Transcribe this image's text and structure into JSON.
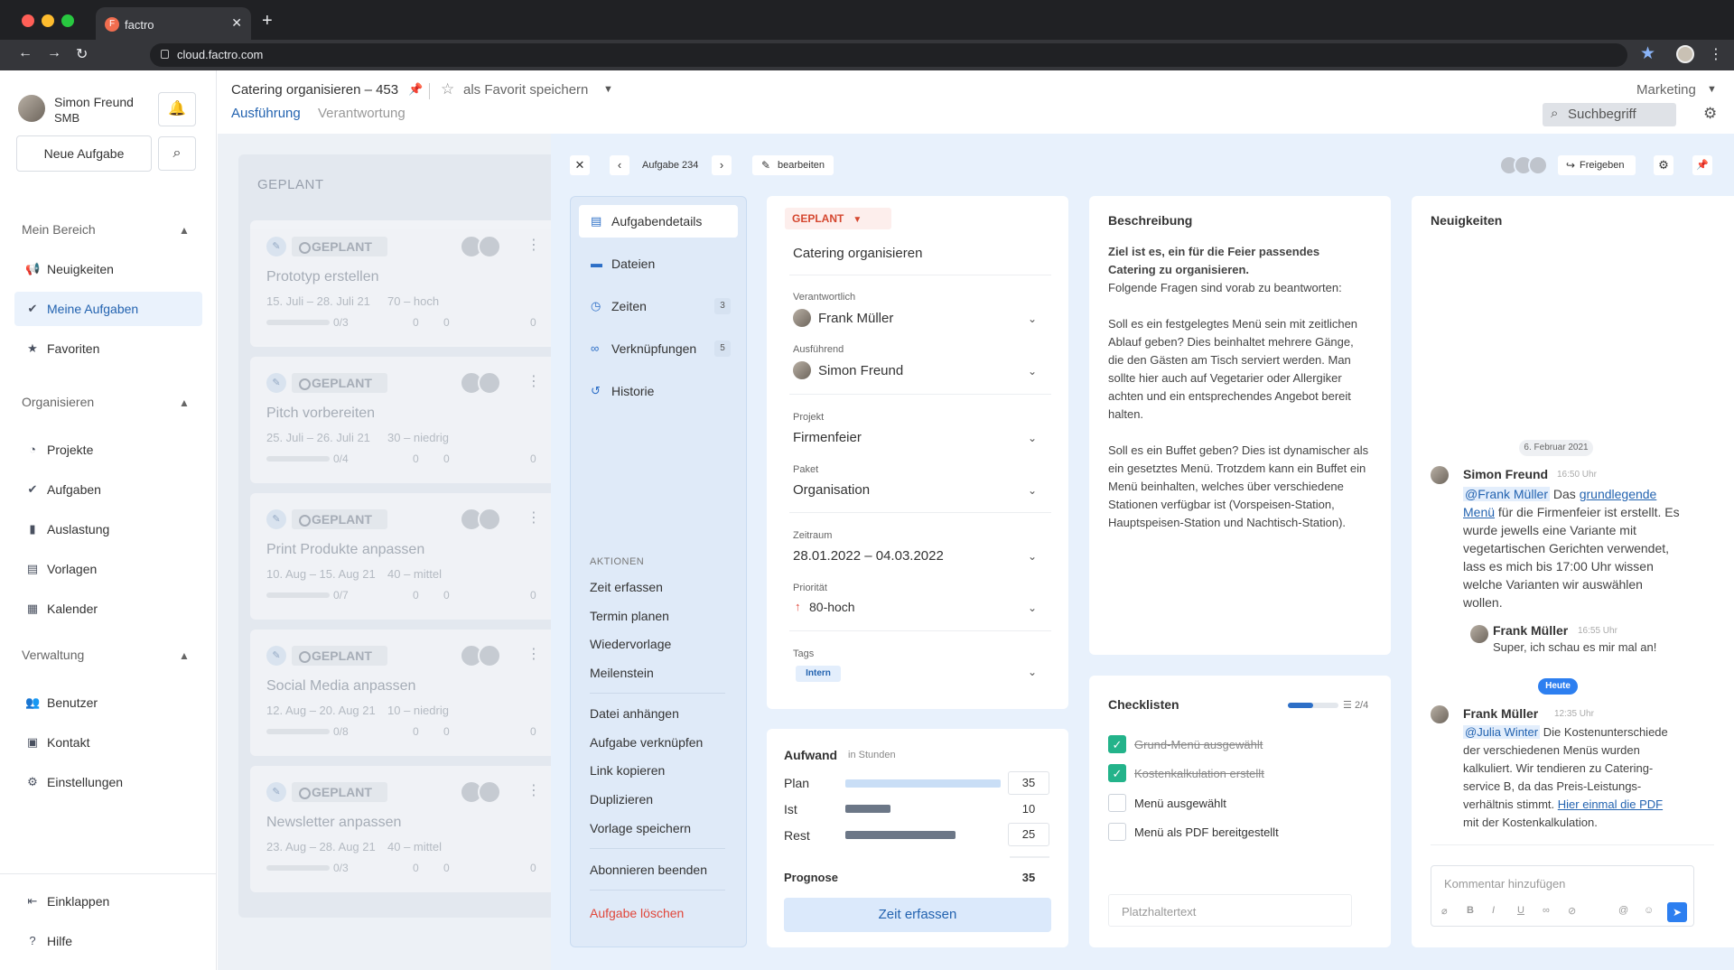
{
  "browser": {
    "tab_title": "factro",
    "tab_favicon": "F",
    "url": "cloud.factro.com",
    "traffic": [
      "#ff5f57",
      "#febc2e",
      "#28c840"
    ]
  },
  "sidebar": {
    "user_name": "Simon Freund",
    "user_role": "SMB",
    "new_task": "Neue Aufgabe",
    "sections": [
      {
        "title": "Mein Bereich",
        "items": [
          {
            "label": "Neuigkeiten",
            "icon": "📢"
          },
          {
            "label": "Meine Aufgaben",
            "icon": "✔"
          },
          {
            "label": "Favoriten",
            "icon": "★"
          }
        ]
      },
      {
        "title": "Organisieren",
        "items": [
          {
            "label": "Projekte",
            "icon": "◔"
          },
          {
            "label": "Aufgaben",
            "icon": "✔"
          },
          {
            "label": "Auslastung",
            "icon": "▮"
          },
          {
            "label": "Vorlagen",
            "icon": "▤"
          },
          {
            "label": "Kalender",
            "icon": "▦"
          }
        ]
      },
      {
        "title": "Verwaltung",
        "items": [
          {
            "label": "Benutzer",
            "icon": "👥"
          },
          {
            "label": "Kontakt",
            "icon": "▣"
          },
          {
            "label": "Einstellungen",
            "icon": "⚙"
          }
        ]
      }
    ],
    "collapse": "Einklappen",
    "help": "Hilfe"
  },
  "header": {
    "title": "Catering organisieren – 453",
    "favorite": "als Favorit speichern",
    "tab_active": "Ausführung",
    "tab_inactive": "Verantwortung",
    "workspace": "Marketing",
    "search_placeholder": "Suchbegriff"
  },
  "board": {
    "title": "GEPLANT",
    "cards": [
      {
        "status": "GEPLANT",
        "title": "Prototyp erstellen",
        "dates": "15. Juli – 28. Juli 21",
        "priority": "70 – hoch",
        "checklist": "0/3",
        "comments": "0",
        "files": "0",
        "links": "0"
      },
      {
        "status": "GEPLANT",
        "title": "Pitch vorbereiten",
        "dates": "25. Juli – 26. Juli 21",
        "priority": "30 – niedrig",
        "checklist": "0/4",
        "comments": "0",
        "files": "0",
        "links": "0"
      },
      {
        "status": "GEPLANT",
        "title": "Print Produkte anpassen",
        "dates": "10. Aug – 15. Aug 21",
        "priority": "40 – mittel",
        "checklist": "0/7",
        "comments": "0",
        "files": "0",
        "links": "0"
      },
      {
        "status": "GEPLANT",
        "title": "Social Media anpassen",
        "dates": "12. Aug – 20. Aug 21",
        "priority": "10 – niedrig",
        "checklist": "0/8",
        "comments": "0",
        "files": "0",
        "links": "0"
      },
      {
        "status": "GEPLANT",
        "title": "Newsletter anpassen",
        "dates": "23. Aug – 28. Aug 21",
        "priority": "40 – mittel",
        "checklist": "0/3",
        "comments": "0",
        "files": "0",
        "links": "0"
      }
    ]
  },
  "panel": {
    "task_number": "Aufgabe 234",
    "edit": "bearbeiten",
    "share": "Freigeben",
    "menu": [
      {
        "label": "Aufgabendetails",
        "icon": "▤",
        "count": ""
      },
      {
        "label": "Dateien",
        "icon": "▬",
        "count": ""
      },
      {
        "label": "Zeiten",
        "icon": "◷",
        "count": "3"
      },
      {
        "label": "Verknüpfungen",
        "icon": "∞",
        "count": "5"
      },
      {
        "label": "Historie",
        "icon": "↺",
        "count": ""
      }
    ],
    "actions_title": "AKTIONEN",
    "actions": [
      "Zeit erfassen",
      "Termin planen",
      "Wiedervorlage",
      "Meilenstein",
      "Datei anhängen",
      "Aufgabe verknüpfen",
      "Link kopieren",
      "Duplizieren",
      "Vorlage speichern",
      "Abonnieren beenden"
    ],
    "delete": "Aufgabe löschen"
  },
  "details": {
    "status": "GEPLANT",
    "title": "Catering organisieren",
    "fields": [
      {
        "label": "Verantwortlich",
        "value": "Frank Müller"
      },
      {
        "label": "Ausführend",
        "value": "Simon Freund"
      },
      {
        "label": "Projekt",
        "value": "Firmenfeier"
      },
      {
        "label": "Paket",
        "value": "Organisation"
      },
      {
        "label": "Zeitraum",
        "value": "28.01.2022 – 04.03.2022"
      },
      {
        "label": "Priorität",
        "value": "80-hoch"
      },
      {
        "label": "Tags",
        "value": "Intern"
      }
    ]
  },
  "effort": {
    "title": "Aufwand",
    "unit": "in Stunden",
    "rows": [
      {
        "label": "Plan",
        "value": "35",
        "fill": 1.0,
        "color": "#c9def6"
      },
      {
        "label": "Ist",
        "value": "10",
        "fill": 0.29,
        "color": "#6c7787"
      },
      {
        "label": "Rest",
        "value": "25",
        "fill": 0.71,
        "color": "#6c7787"
      }
    ],
    "forecast_label": "Prognose",
    "forecast_value": "35",
    "record": "Zeit erfassen"
  },
  "description": {
    "title": "Beschreibung",
    "bold": "Ziel ist es, ein für die Feier passendes Catering zu organisieren.",
    "p1": "Folgende Fragen sind vorab zu beantworten:",
    "p2": "Soll es ein festgelegtes Menü sein mit zeitlichen Ablauf geben? Dies beinhaltet mehrere Gänge, die den Gästen am Tisch serviert werden. Man sollte hier auch auf Vegetarier oder Allergiker achten und ein entsprechendes Angebot bereit halten.",
    "p3": "Soll es ein Buffet geben? Dies ist dynamischer als ein gesetztes Menü. Trotzdem kann ein Buffet ein Menü beinhalten, welches über verschiedene Stationen verfügbar ist (Vorspeisen-Station, Hauptspeisen-Station und Nachtisch-Station)."
  },
  "checklist": {
    "title": "Checklisten",
    "progress": "2/4",
    "progress_fraction": 0.5,
    "items": [
      {
        "text": "Grund-Menü ausgewählt",
        "done": true
      },
      {
        "text": "Kostenkalkulation erstellt",
        "done": true
      },
      {
        "text": "Menü ausgewählt",
        "done": false
      },
      {
        "text": "Menü als PDF bereitgestellt",
        "done": false
      }
    ],
    "placeholder": "Platzhaltertext"
  },
  "news": {
    "title": "Neuigkeiten",
    "date1": "6. Februar 2021",
    "m1_name": "Simon Freund",
    "m1_time": "16:50 Uhr",
    "m1_mention": "@Frank Müller",
    "m1_t1": "Das",
    "m1_link": "grundlegende Menü",
    "m1_t2": "für die Firmenfeier ist erstellt. Es wurde jewells eine Variante mit vegetartischen Gerichten verwendet, lass es mich bis 17:00 Uhr wissen welche Varianten wir auswählen wollen.",
    "m2_name": "Frank Müller",
    "m2_time": "16:55 Uhr",
    "m2_text": "Super, ich schau es mir mal an!",
    "date2": "Heute",
    "m3_name": "Frank Müller",
    "m3_time": "12:35 Uhr",
    "m3_mention": "@Julia Winter",
    "m3_t1": "Die Kostenunterschiede der verschiedenen Menüs wurden kalkuliert. Wir tendieren zu Catering-service B, da das Preis-Leistungs-verhältnis stimmt.",
    "m3_link": "Hier einmal die PDF",
    "m3_t2": "mit der Kostenkalkulation.",
    "comment_placeholder": "Kommentar hinzufügen"
  }
}
